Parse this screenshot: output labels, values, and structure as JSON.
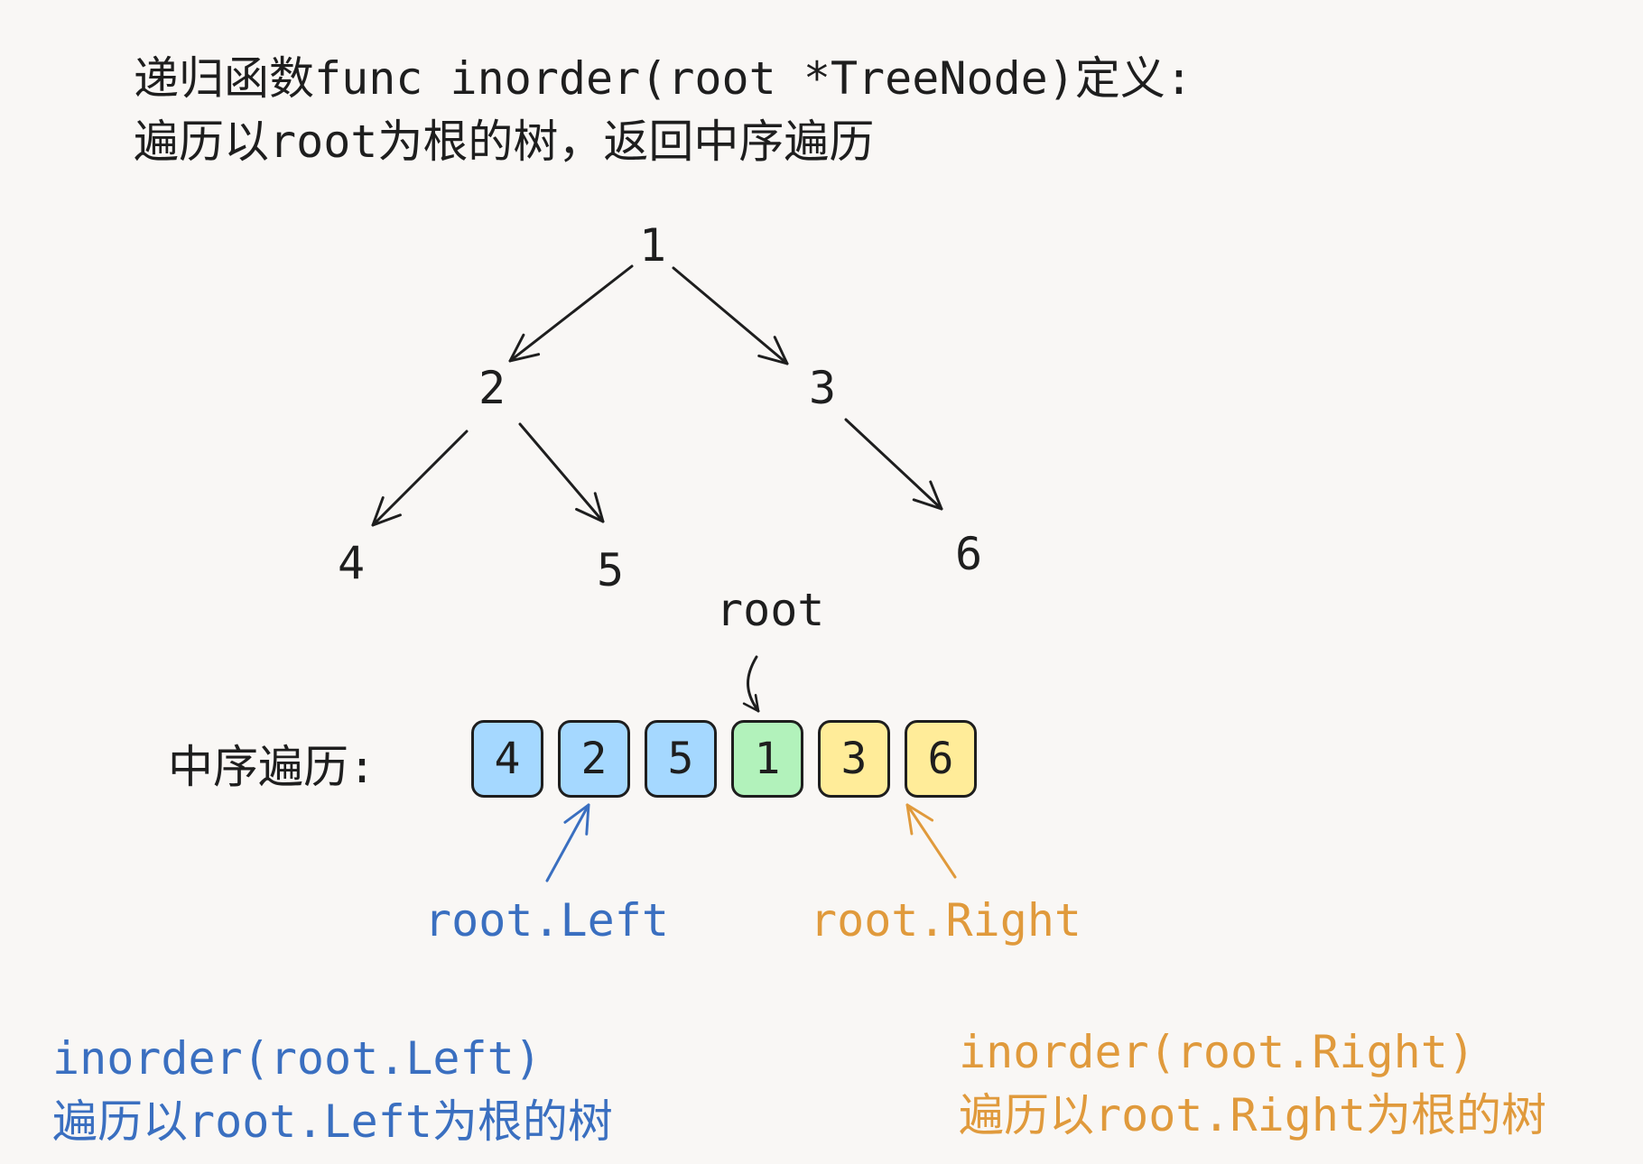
{
  "header": {
    "line1": "递归函数func inorder(root *TreeNode)定义:",
    "line2": "遍历以root为根的树，返回中序遍历"
  },
  "tree": {
    "nodes": [
      {
        "id": "n1",
        "label": "1"
      },
      {
        "id": "n2",
        "label": "2"
      },
      {
        "id": "n3",
        "label": "3"
      },
      {
        "id": "n4",
        "label": "4"
      },
      {
        "id": "n5",
        "label": "5"
      },
      {
        "id": "n6",
        "label": "6"
      }
    ],
    "edges": [
      {
        "from": "n1",
        "to": "n2"
      },
      {
        "from": "n1",
        "to": "n3"
      },
      {
        "from": "n2",
        "to": "n4"
      },
      {
        "from": "n2",
        "to": "n5"
      },
      {
        "from": "n3",
        "to": "n6"
      }
    ]
  },
  "traversal": {
    "label": "中序遍历:",
    "items": [
      {
        "value": "4",
        "group": "left"
      },
      {
        "value": "2",
        "group": "left"
      },
      {
        "value": "5",
        "group": "left"
      },
      {
        "value": "1",
        "group": "root"
      },
      {
        "value": "3",
        "group": "right"
      },
      {
        "value": "6",
        "group": "right"
      }
    ]
  },
  "pointers": {
    "root": "root",
    "left": "root.Left",
    "right": "root.Right"
  },
  "footer": {
    "left_call": "inorder(root.Left)",
    "left_desc": "遍历以root.Left为根的树",
    "right_call": "inorder(root.Right)",
    "right_desc": "遍历以root.Right为根的树"
  },
  "colors": {
    "left_fill": "#a5d8ff",
    "root_fill": "#b2f2bb",
    "right_fill": "#ffec99",
    "left_text": "#3a6fc0",
    "right_text": "#e09a3c",
    "stroke": "#1e1e1e",
    "background": "#f9f7f5"
  }
}
